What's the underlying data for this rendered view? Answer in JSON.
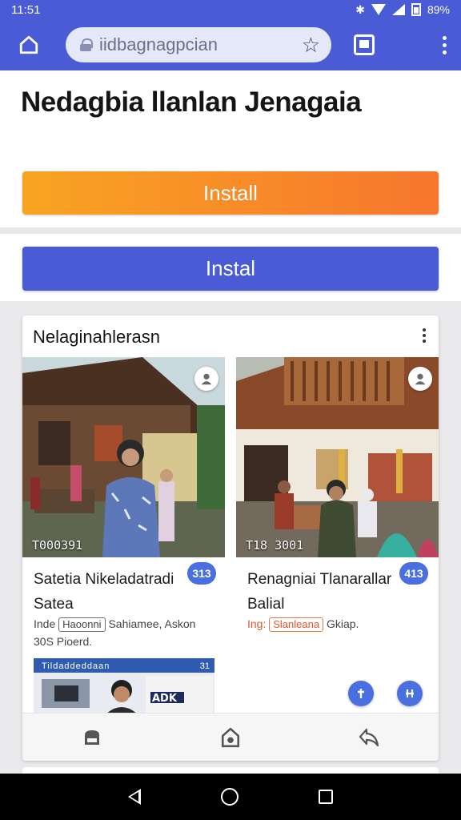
{
  "status_bar": {
    "time": "11:51",
    "battery": "89%"
  },
  "browser": {
    "url": "iidbagnagpcian"
  },
  "page": {
    "title": "Nedagbia llanlan Jenagaia",
    "install_primary_label": "Install",
    "install_secondary_label": "Instal"
  },
  "card": {
    "title": "Nelaginahlerasn",
    "tiles": [
      {
        "image_code": "T000391",
        "title": "Satetia Nikeladatradi Satea",
        "badge": "313",
        "meta_prefix": "Inde",
        "tag": "Haoonni",
        "meta_suffix": "Sahiamee, Askon",
        "meta_line2": "30S Pioerd.",
        "thumb_label": "Tildaddeddaan",
        "thumb_num": "31"
      },
      {
        "image_code": "T18 3001",
        "title": "Renagniai Tlanarallar Balial",
        "badge": "413",
        "meta_prefix": "Ing:",
        "tag": "Slanleana",
        "meta_suffix": "Gkiap."
      }
    ],
    "icons": {
      "photo_badge": "person-icon",
      "bottom_nav": [
        "shop-icon",
        "store-home-icon",
        "share-icon"
      ]
    }
  },
  "colors": {
    "accent": "#4a5bd6",
    "install_orange_start": "#f8a422",
    "install_orange_end": "#f7762d",
    "badge_blue": "#4a6fe0"
  }
}
